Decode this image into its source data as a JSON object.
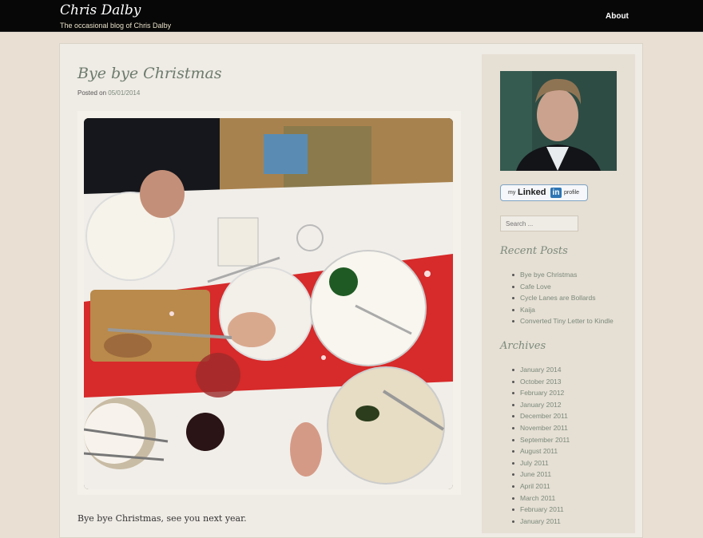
{
  "header": {
    "site_title": "Chris Dalby",
    "site_description": "The occasional blog of Chris Dalby",
    "nav": [
      {
        "label": "About"
      }
    ]
  },
  "post": {
    "title": "Bye bye Christmas",
    "posted_on_label": "Posted on",
    "date": "05/01/2014",
    "body": "Bye bye Christmas, see you next year."
  },
  "sidebar": {
    "linkedin": {
      "my": "my",
      "brand": "Linked",
      "in": "in",
      "profile": "profile"
    },
    "search": {
      "placeholder": "Search ..."
    },
    "recent_posts": {
      "title": "Recent Posts",
      "items": [
        "Bye bye Christmas",
        "Cafe Love",
        "Cycle Lanes are Bollards",
        "Kaija",
        "Converted Tiny Letter to Kindle"
      ]
    },
    "archives": {
      "title": "Archives",
      "items": [
        "January 2014",
        "October 2013",
        "February 2012",
        "January 2012",
        "December 2011",
        "November 2011",
        "September 2011",
        "August 2011",
        "July 2011",
        "June 2011",
        "April 2011",
        "March 2011",
        "February 2011",
        "January 2011"
      ]
    }
  },
  "colors": {
    "header_bg": "#070707",
    "page_bg": "#e9e0d3",
    "content_bg": "#efebe5",
    "title_green": "#6c7b6d",
    "link_green": "#7a8a7b",
    "linkedin_blue": "#2d75b4"
  }
}
